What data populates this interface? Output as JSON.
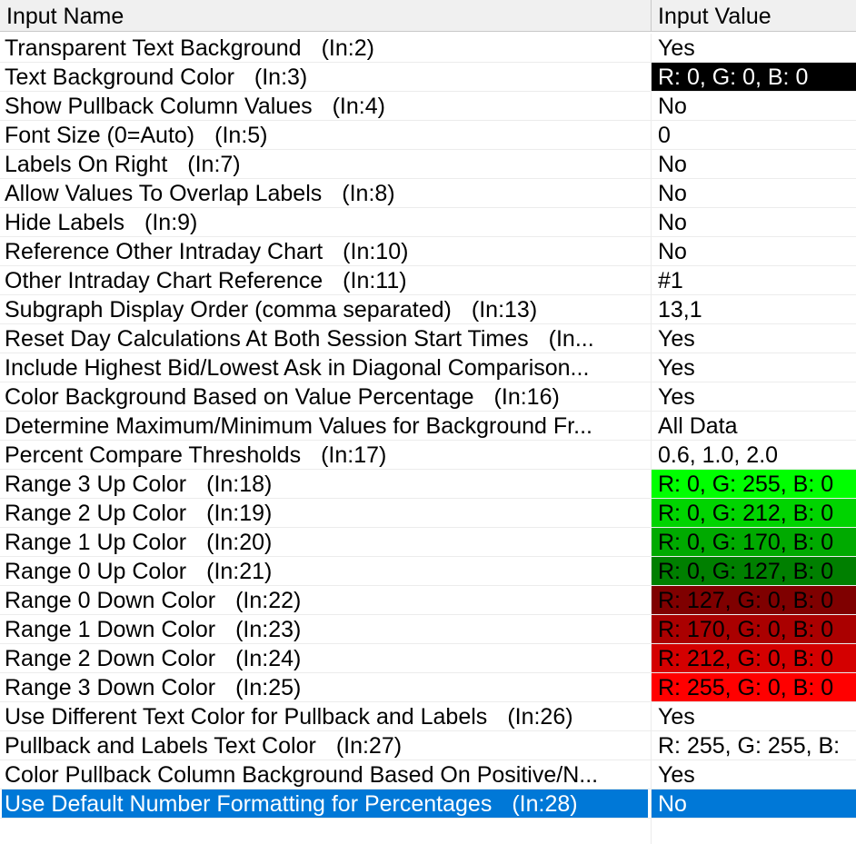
{
  "header": {
    "name_label": "Input Name",
    "value_label": "Input Value"
  },
  "rows": [
    {
      "name": "Transparent Text Background",
      "index": "(In:2)",
      "value": "Yes"
    },
    {
      "name": "Text Background Color",
      "index": "(In:3)",
      "value": "R: 0, G: 0, B: 0",
      "swatch": "#000000",
      "text_color": "#ffffff"
    },
    {
      "name": "Show Pullback Column Values",
      "index": "(In:4)",
      "value": "No"
    },
    {
      "name": "Font Size (0=Auto)",
      "index": "(In:5)",
      "value": "0"
    },
    {
      "name": "Labels On Right",
      "index": "(In:7)",
      "value": "No"
    },
    {
      "name": "Allow Values To Overlap Labels",
      "index": "(In:8)",
      "value": "No"
    },
    {
      "name": "Hide Labels",
      "index": "(In:9)",
      "value": "No"
    },
    {
      "name": "Reference Other Intraday Chart",
      "index": "(In:10)",
      "value": "No"
    },
    {
      "name": "Other Intraday Chart Reference",
      "index": "(In:11)",
      "value": "#1"
    },
    {
      "name": "Subgraph Display Order (comma separated)",
      "index": "(In:13)",
      "value": "13,1"
    },
    {
      "name": "Reset Day Calculations At Both Session Start Times",
      "index": "(In...",
      "value": "Yes"
    },
    {
      "name": "Include Highest Bid/Lowest Ask in Diagonal Comparison...",
      "index": "",
      "value": "Yes"
    },
    {
      "name": "Color Background Based on Value Percentage",
      "index": "(In:16)",
      "value": "Yes"
    },
    {
      "name": "Determine Maximum/Minimum Values for Background Fr...",
      "index": "",
      "value": "All Data"
    },
    {
      "name": "Percent Compare Thresholds",
      "index": "(In:17)",
      "value": "0.6, 1.0, 2.0"
    },
    {
      "name": "Range 3 Up Color",
      "index": "(In:18)",
      "value": "R: 0, G: 255, B: 0",
      "swatch": "#00ff00",
      "text_color": "#000000"
    },
    {
      "name": "Range 2 Up Color",
      "index": "(In:19)",
      "value": "R: 0, G: 212, B: 0",
      "swatch": "#00d400",
      "text_color": "#000000"
    },
    {
      "name": "Range 1 Up Color",
      "index": "(In:20)",
      "value": "R: 0, G: 170, B: 0",
      "swatch": "#00aa00",
      "text_color": "#000000"
    },
    {
      "name": "Range 0 Up Color",
      "index": "(In:21)",
      "value": "R: 0, G: 127, B: 0",
      "swatch": "#007f00",
      "text_color": "#000000"
    },
    {
      "name": "Range 0 Down Color",
      "index": "(In:22)",
      "value": "R: 127, G: 0, B: 0",
      "swatch": "#7f0000",
      "text_color": "#000000"
    },
    {
      "name": "Range 1 Down Color",
      "index": "(In:23)",
      "value": "R: 170, G: 0, B: 0",
      "swatch": "#aa0000",
      "text_color": "#000000"
    },
    {
      "name": "Range 2 Down Color",
      "index": "(In:24)",
      "value": "R: 212, G: 0, B: 0",
      "swatch": "#d40000",
      "text_color": "#000000"
    },
    {
      "name": "Range 3 Down Color",
      "index": "(In:25)",
      "value": "R: 255, G: 0, B: 0",
      "swatch": "#ff0000",
      "text_color": "#000000"
    },
    {
      "name": "Use Different Text Color for Pullback and Labels",
      "index": "(In:26)",
      "value": "Yes"
    },
    {
      "name": "Pullback and Labels Text Color",
      "index": "(In:27)",
      "value": "R: 255, G: 255, B:"
    },
    {
      "name": "Color Pullback Column Background Based On Positive/N...",
      "index": "",
      "value": "Yes"
    },
    {
      "name": "Use Default Number Formatting for Percentages",
      "index": "(In:28)",
      "value": "No",
      "selected": true
    }
  ],
  "colors": {
    "selection": "#0078d7",
    "header_bg": "#f0f0f0",
    "grid_line": "#ececec"
  }
}
